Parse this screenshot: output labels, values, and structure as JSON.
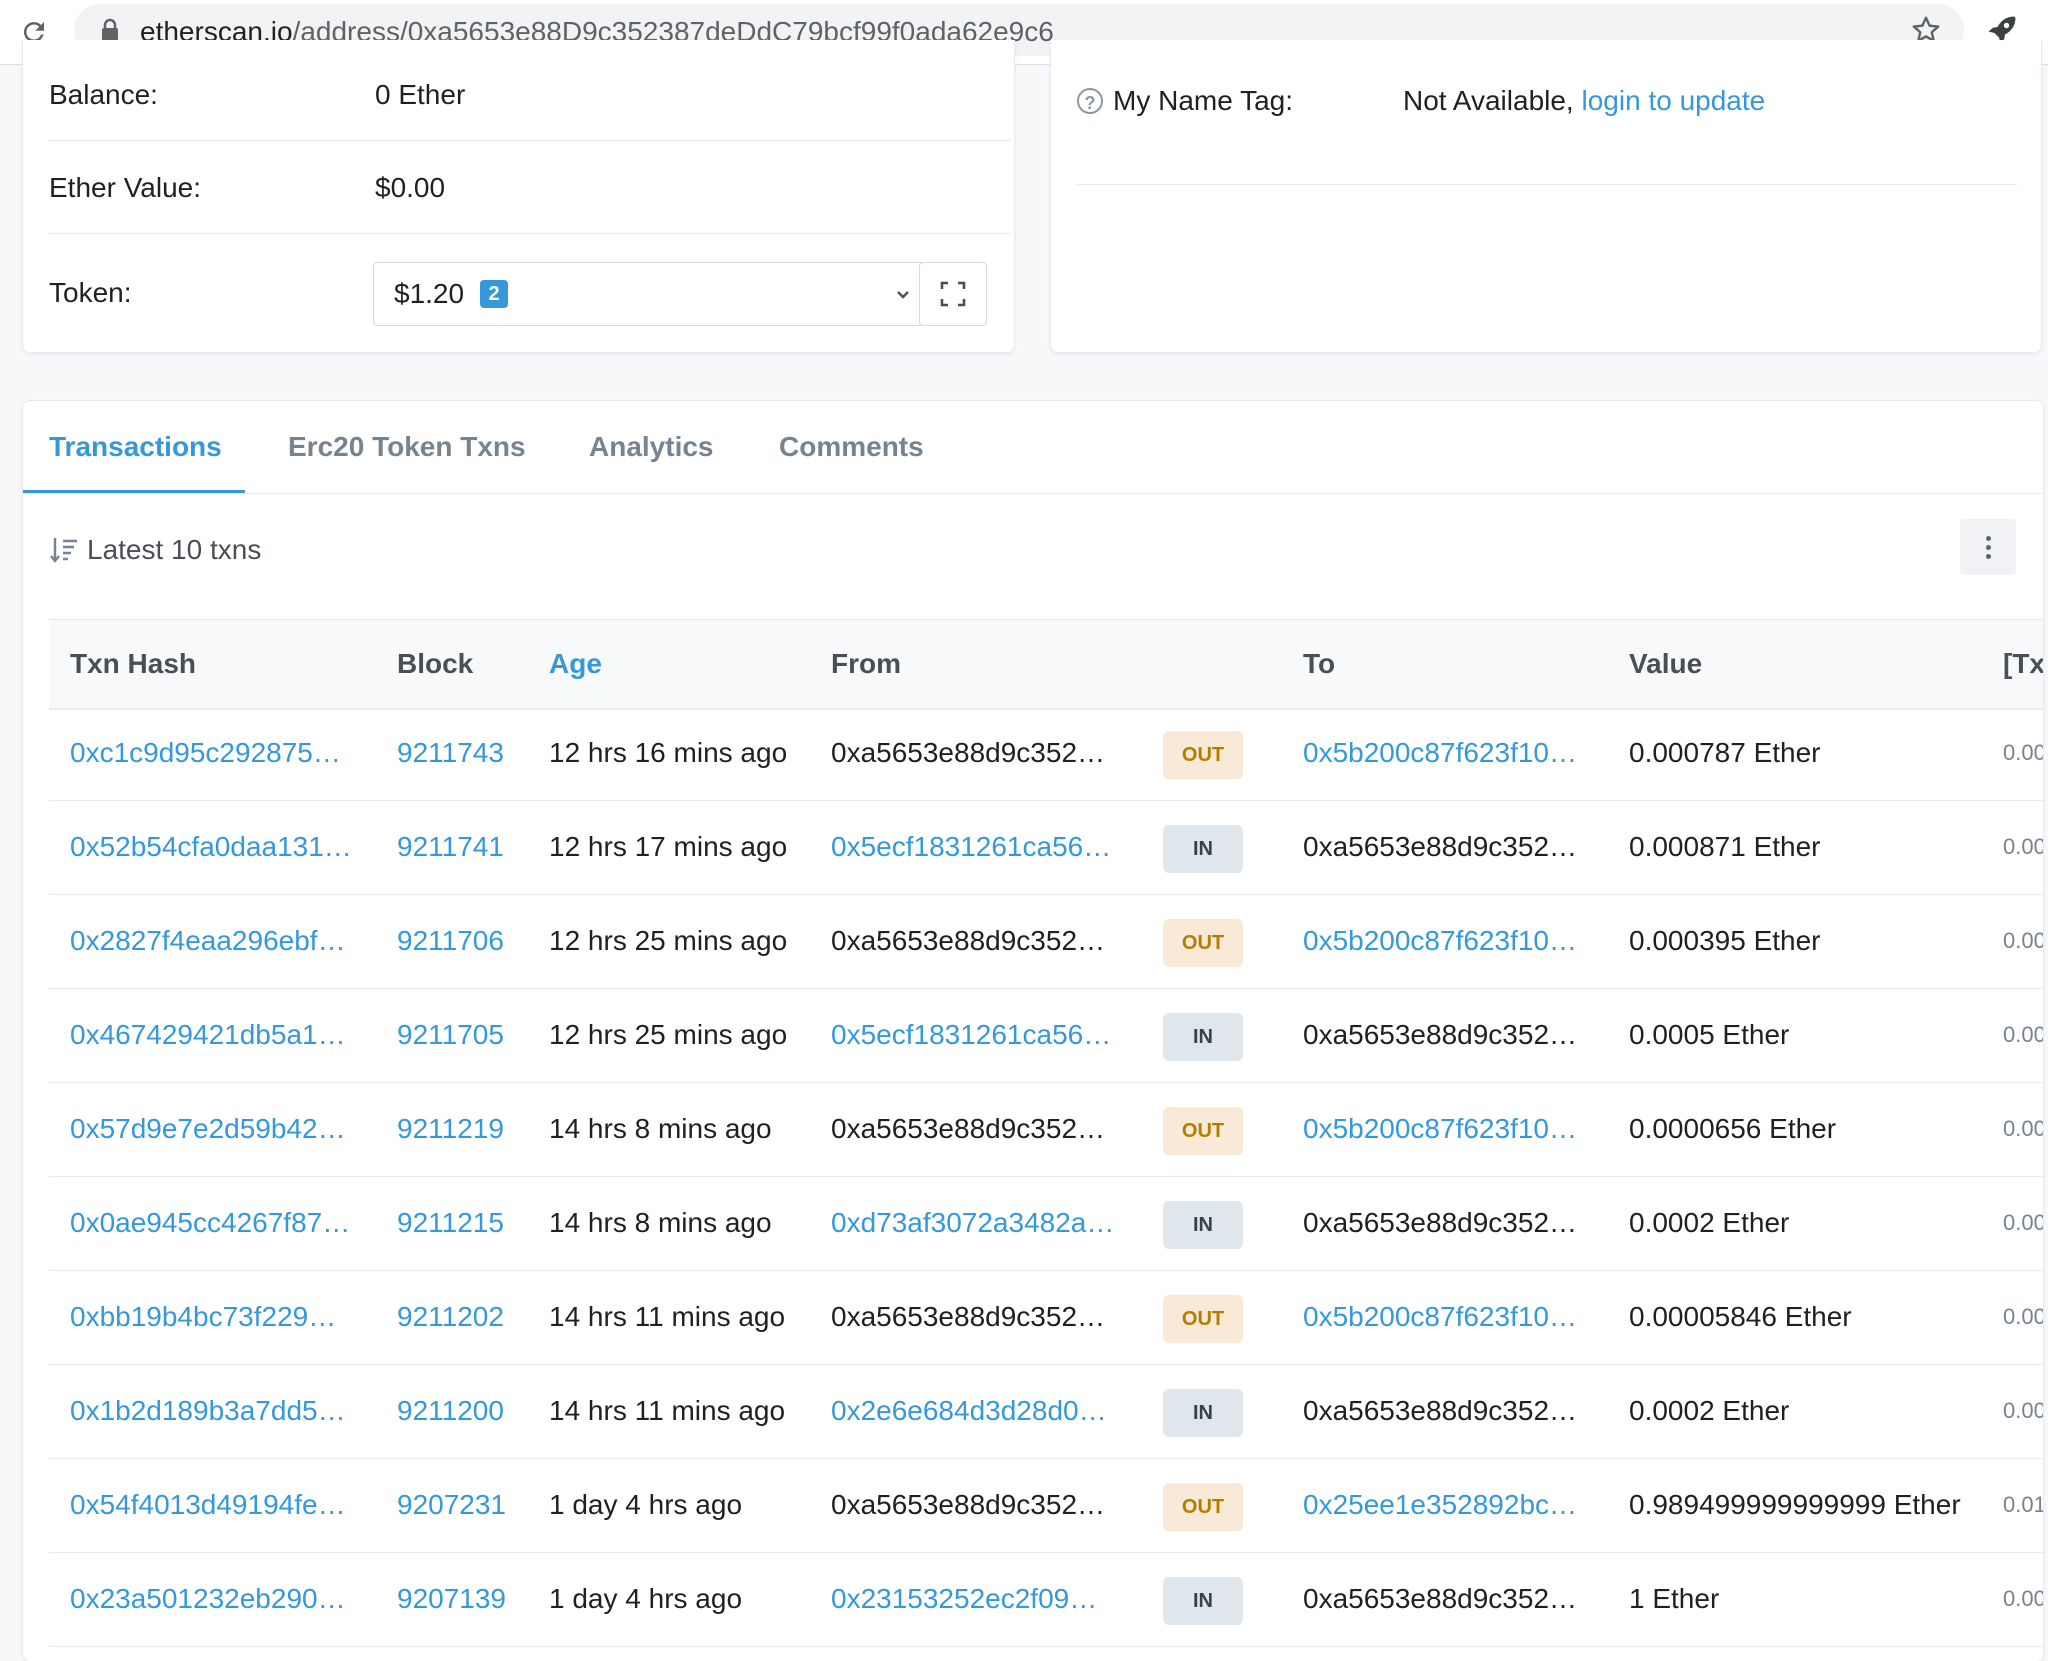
{
  "browser": {
    "url_host": "etherscan.io",
    "url_path": "/address/0xa5653e88D9c352387deDdC79bcf99f0ada62e9c6"
  },
  "overview": {
    "balance_label": "Balance:",
    "balance_value": "0 Ether",
    "ether_value_label": "Ether Value:",
    "ether_value": "$0.00",
    "token_label": "Token:",
    "token_value": "$1.20",
    "token_count": "2"
  },
  "more_info": {
    "name_tag_label": "My Name Tag:",
    "name_tag_value": "Not Available,",
    "name_tag_link": "login to update"
  },
  "tabs": [
    {
      "label": "Transactions",
      "active": true
    },
    {
      "label": "Erc20 Token Txns",
      "active": false
    },
    {
      "label": "Analytics",
      "active": false
    },
    {
      "label": "Comments",
      "active": false
    }
  ],
  "latest_label": "Latest 10 txns",
  "table": {
    "headers": [
      "Txn Hash",
      "Block",
      "Age",
      "From",
      "To",
      "Value",
      "[Tx"
    ],
    "rows": [
      {
        "hash": "0xc1c9d95c292875…",
        "block": "9211743",
        "age": "12 hrs 16 mins ago",
        "from": "0xa5653e88d9c352…",
        "dir": "OUT",
        "to": "0x5b200c87f623f10…",
        "value": "0.000787 Ether",
        "fee": "0.00"
      },
      {
        "hash": "0x52b54cfa0daa131…",
        "block": "9211741",
        "age": "12 hrs 17 mins ago",
        "from": "0x5ecf1831261ca56…",
        "dir": "IN",
        "to": "0xa5653e88d9c352…",
        "value": "0.000871 Ether",
        "fee": "0.00"
      },
      {
        "hash": "0x2827f4eaa296ebf…",
        "block": "9211706",
        "age": "12 hrs 25 mins ago",
        "from": "0xa5653e88d9c352…",
        "dir": "OUT",
        "to": "0x5b200c87f623f10…",
        "value": "0.000395 Ether",
        "fee": "0.00"
      },
      {
        "hash": "0x467429421db5a1…",
        "block": "9211705",
        "age": "12 hrs 25 mins ago",
        "from": "0x5ecf1831261ca56…",
        "dir": "IN",
        "to": "0xa5653e88d9c352…",
        "value": "0.0005 Ether",
        "fee": "0.00"
      },
      {
        "hash": "0x57d9e7e2d59b42…",
        "block": "9211219",
        "age": "14 hrs 8 mins ago",
        "from": "0xa5653e88d9c352…",
        "dir": "OUT",
        "to": "0x5b200c87f623f10…",
        "value": "0.0000656 Ether",
        "fee": "0.00"
      },
      {
        "hash": "0x0ae945cc4267f87…",
        "block": "9211215",
        "age": "14 hrs 8 mins ago",
        "from": "0xd73af3072a3482a…",
        "dir": "IN",
        "to": "0xa5653e88d9c352…",
        "value": "0.0002 Ether",
        "fee": "0.00"
      },
      {
        "hash": "0xbb19b4bc73f229…",
        "block": "9211202",
        "age": "14 hrs 11 mins ago",
        "from": "0xa5653e88d9c352…",
        "dir": "OUT",
        "to": "0x5b200c87f623f10…",
        "value": "0.00005846 Ether",
        "fee": "0.00"
      },
      {
        "hash": "0x1b2d189b3a7dd5…",
        "block": "9211200",
        "age": "14 hrs 11 mins ago",
        "from": "0x2e6e684d3d28d0…",
        "dir": "IN",
        "to": "0xa5653e88d9c352…",
        "value": "0.0002 Ether",
        "fee": "0.00"
      },
      {
        "hash": "0x54f4013d49194fe…",
        "block": "9207231",
        "age": "1 day 4 hrs ago",
        "from": "0xa5653e88d9c352…",
        "dir": "OUT",
        "to": "0x25ee1e352892bc…",
        "value": "0.989499999999999 Ether",
        "fee": "0.01"
      },
      {
        "hash": "0x23a501232eb290…",
        "block": "9207139",
        "age": "1 day 4 hrs ago",
        "from": "0x23153252ec2f09…",
        "dir": "IN",
        "to": "0xa5653e88d9c352…",
        "value": "1 Ether",
        "fee": "0.00"
      }
    ]
  },
  "colors": {
    "link": "#3498db",
    "out_badge_bg": "#f8ead6",
    "in_badge_bg": "#dfe7ec"
  }
}
